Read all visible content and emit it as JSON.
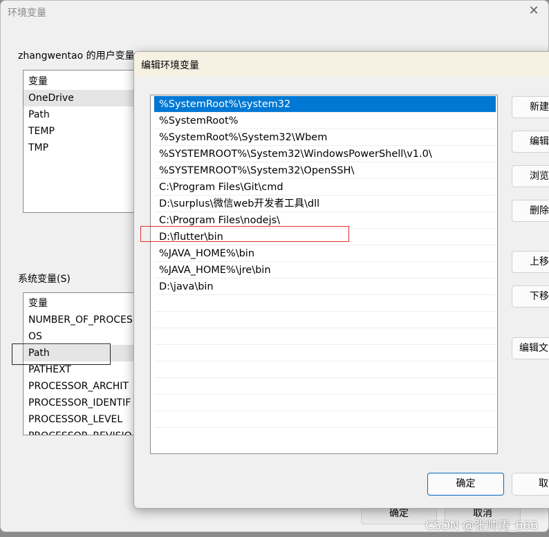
{
  "background_dialog": {
    "title": "环境变量",
    "user_group_label": "zhangwentao 的用户变量",
    "user_vars_header": "变量",
    "user_vars": [
      "OneDrive",
      "Path",
      "TEMP",
      "TMP"
    ],
    "system_group_label": "系统变量(S)",
    "system_vars_header": "变量",
    "system_vars": [
      "NUMBER_OF_PROCES",
      "OS",
      "Path",
      "PATHEXT",
      "PROCESSOR_ARCHIT",
      "PROCESSOR_IDENTIF",
      "PROCESSOR_LEVEL",
      "PROCESSOR_REVISIO"
    ],
    "ok_label": "确定",
    "cancel_label": "取消"
  },
  "edit_dialog": {
    "title": "编辑环境变量",
    "entries": [
      "%SystemRoot%\\system32",
      "%SystemRoot%",
      "%SystemRoot%\\System32\\Wbem",
      "%SYSTEMROOT%\\System32\\WindowsPowerShell\\v1.0\\",
      "%SYSTEMROOT%\\System32\\OpenSSH\\",
      "C:\\Program Files\\Git\\cmd",
      "D:\\surplus\\微信web开发者工具\\dll",
      "C:\\Program Files\\nodejs\\",
      "D:\\flutter\\bin",
      "%JAVA_HOME%\\bin",
      "%JAVA_HOME%\\jre\\bin",
      "D:\\java\\bin"
    ],
    "selected_index": 0,
    "buttons": {
      "new": "新建",
      "edit": "编辑",
      "browse": "浏览",
      "delete": "删除",
      "move_up": "上移",
      "move_down": "下移",
      "edit_text": "编辑文"
    },
    "ok_label": "确定",
    "cancel_label": "取"
  },
  "watermark": "CSDN @张帅涛_666",
  "colors": {
    "selection": "#0078d4",
    "highlight_red": "#e03030"
  }
}
